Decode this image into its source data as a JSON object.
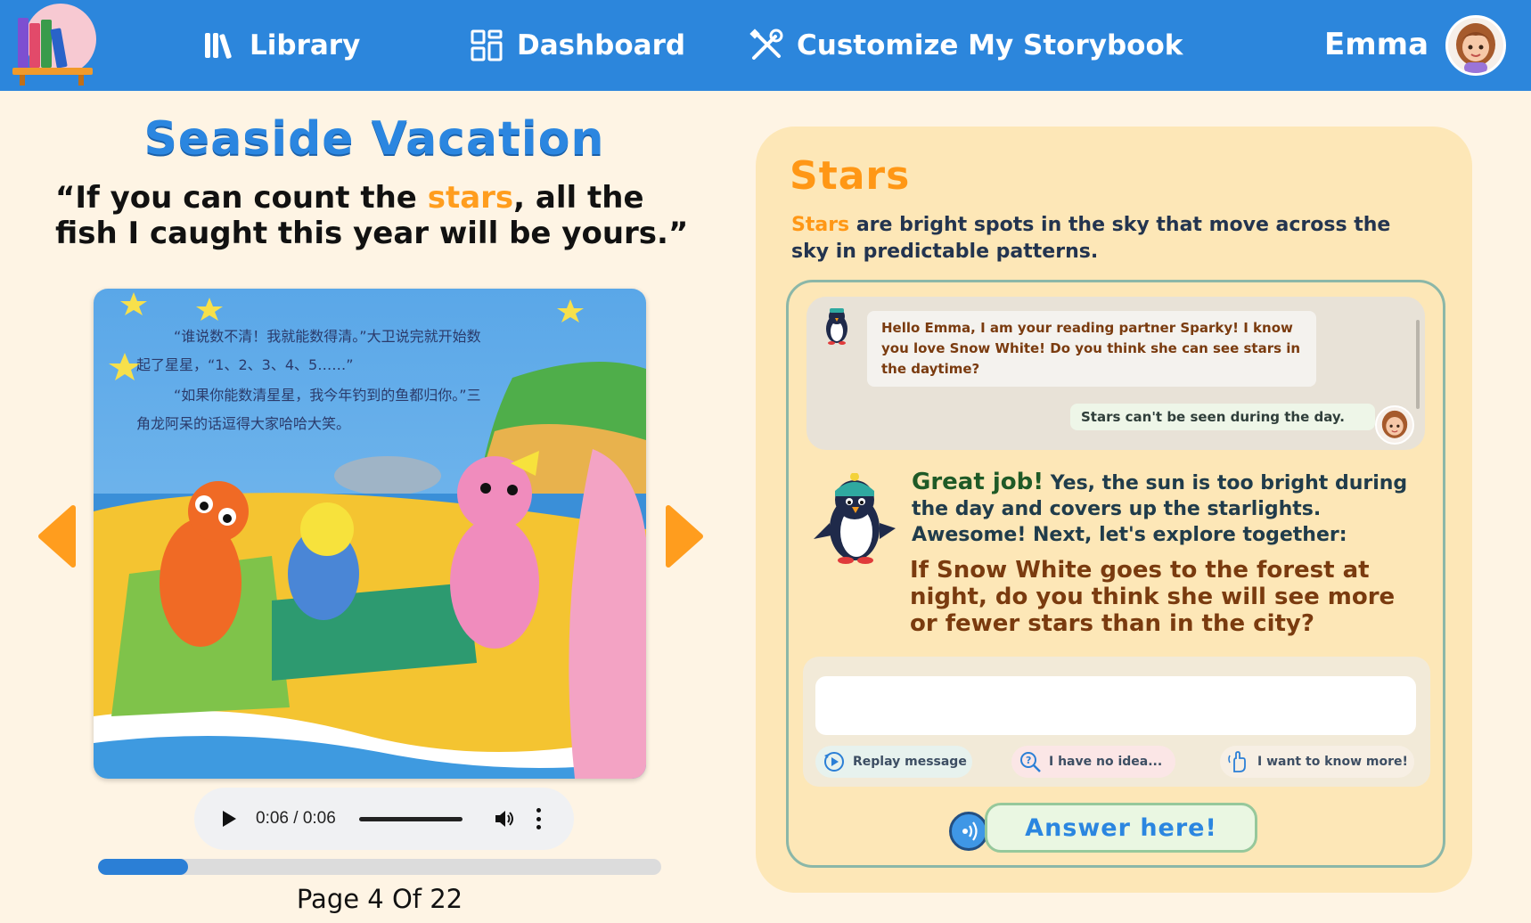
{
  "colors": {
    "header_bg": "#2c86dc",
    "page_bg": "#fef4e4",
    "title_blue": "#2b86e0",
    "highlight_orange": "#ff9d1e",
    "panel_bg": "#fde7b7",
    "arrow_orange": "#ff9d1e"
  },
  "header": {
    "logo_icon": "bookshelf-icon",
    "nav": [
      {
        "label": "Library",
        "icon": "library-icon"
      },
      {
        "label": "Dashboard",
        "icon": "dashboard-icon"
      },
      {
        "label": "Customize My Storybook",
        "icon": "tools-icon"
      }
    ],
    "user_name": "Emma",
    "avatar_icon": "girl-avatar-icon"
  },
  "book": {
    "title": "Seaside Vacation",
    "quote_before": "“If you can count the ",
    "quote_highlight": "stars",
    "quote_after": ", all the fish I caught this year will be yours.”",
    "page_text_lines": [
      "“谁说数不清！我就能数得清。”大卫说完就开始数",
      "起了星星，“1、2、3、4、5……”",
      "“如果你能数清星星，我今年钓到的鱼都归你。”三",
      "角龙阿呆的话逗得大家哈哈大笑。"
    ]
  },
  "audio": {
    "time": "0:06 / 0:06",
    "played_fraction": 1.0
  },
  "reading_progress": {
    "fraction": 0.16,
    "label": "Page 4 Of 22"
  },
  "panel": {
    "word": "Stars",
    "definition_highlight": "Stars",
    "definition_rest": " are bright spots in the sky that move across the sky in predictable patterns.",
    "chat": {
      "bot_icon": "penguin-icon",
      "bot_message": "Hello Emma, I am your reading partner Sparky! I know you love Snow White! Do you think she can see stars in the daytime?",
      "user_message": "Stars can't be seen during the day.",
      "user_icon": "girl-avatar-icon"
    },
    "feedback_great": "Great job!",
    "feedback_text": " Yes, the sun is too bright during the day and covers up the starlights. Awesome! Next, let's explore together:",
    "question": "If Snow White goes to the forest at night, do you think she will see more or fewer stars than in the city?",
    "answer_input": {
      "value": "",
      "placeholder": ""
    },
    "chips": [
      {
        "label": "Replay message",
        "icon": "replay-icon"
      },
      {
        "label": "I have no idea...",
        "icon": "magnifier-question-icon"
      },
      {
        "label": "I want to know more!",
        "icon": "raised-hand-icon"
      }
    ],
    "mic_icon": "microphone-icon",
    "answer_button": "Answer here!"
  }
}
